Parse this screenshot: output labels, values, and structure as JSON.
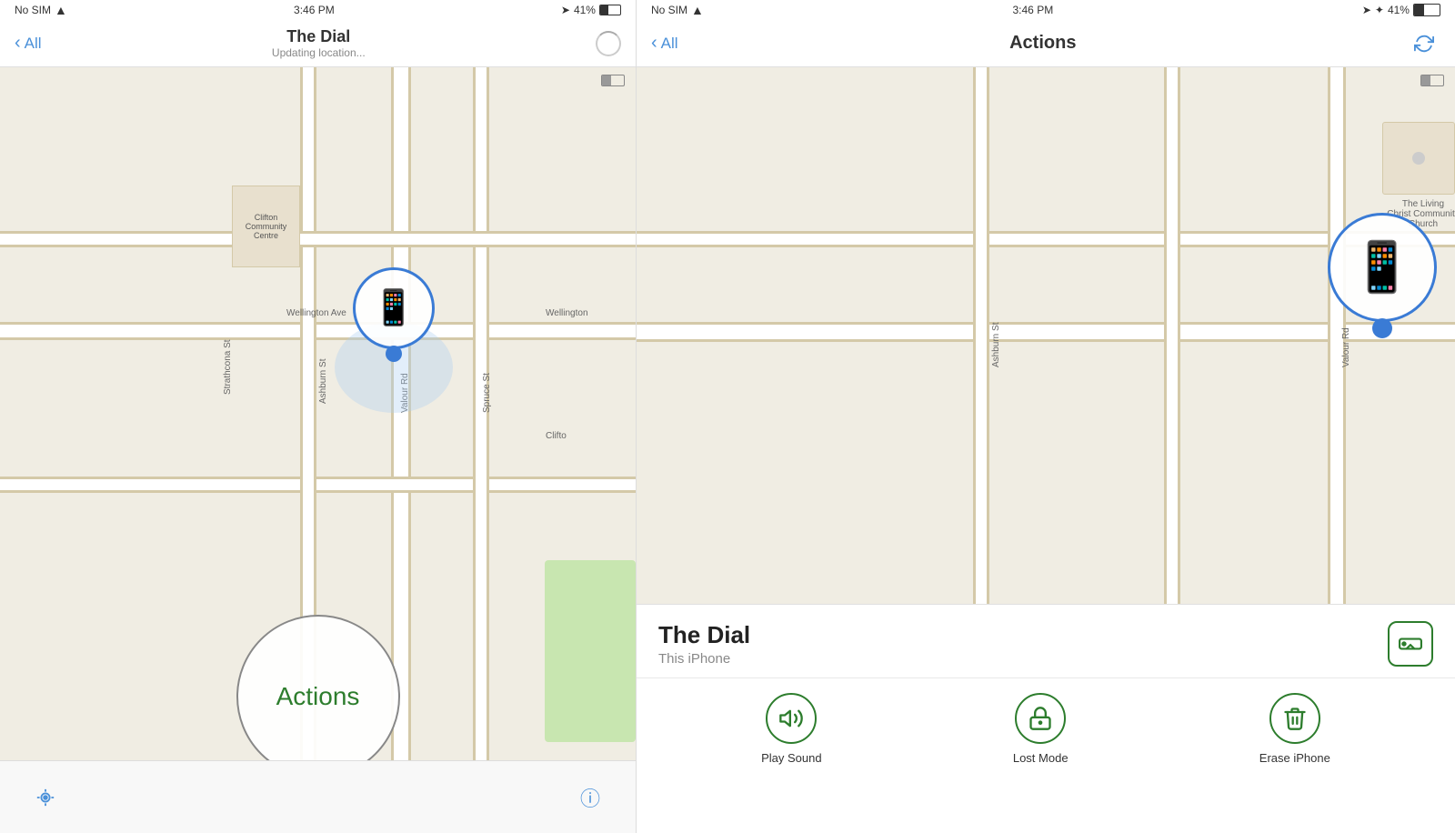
{
  "left_phone": {
    "status_bar": {
      "carrier": "No SIM",
      "time": "3:46 PM",
      "battery_pct": "41%"
    },
    "nav": {
      "back_label": "All",
      "title": "The Dial",
      "subtitle": "Updating location..."
    },
    "map": {
      "labels": [
        "Wellington Ave",
        "Wellington",
        "Clifton",
        "Strathcona St",
        "Ashburn St",
        "Valour Rd",
        "Spruce St"
      ],
      "building_label": "Clifton\nmmunity\nCentre"
    },
    "bottom": {
      "actions_label": "Actions",
      "info_icon": "ⓘ"
    }
  },
  "right_phone": {
    "status_bar": {
      "carrier": "No SIM",
      "time": "3:46 PM",
      "battery_pct": "41%"
    },
    "nav": {
      "back_label": "All",
      "title": "Actions"
    },
    "map": {
      "labels": [
        "The Living\nChrist Community\nChurch",
        "Ashburn St",
        "Valour Rd"
      ]
    },
    "info_panel": {
      "device_name": "The Dial",
      "device_type": "This iPhone",
      "directions_icon": "🚗"
    },
    "actions": [
      {
        "id": "play-sound",
        "label": "Play Sound",
        "icon": "🔊"
      },
      {
        "id": "lost-mode",
        "label": "Lost Mode",
        "icon": "🔒"
      },
      {
        "id": "erase-iphone",
        "label": "Erase iPhone",
        "icon": "🗑"
      }
    ]
  }
}
